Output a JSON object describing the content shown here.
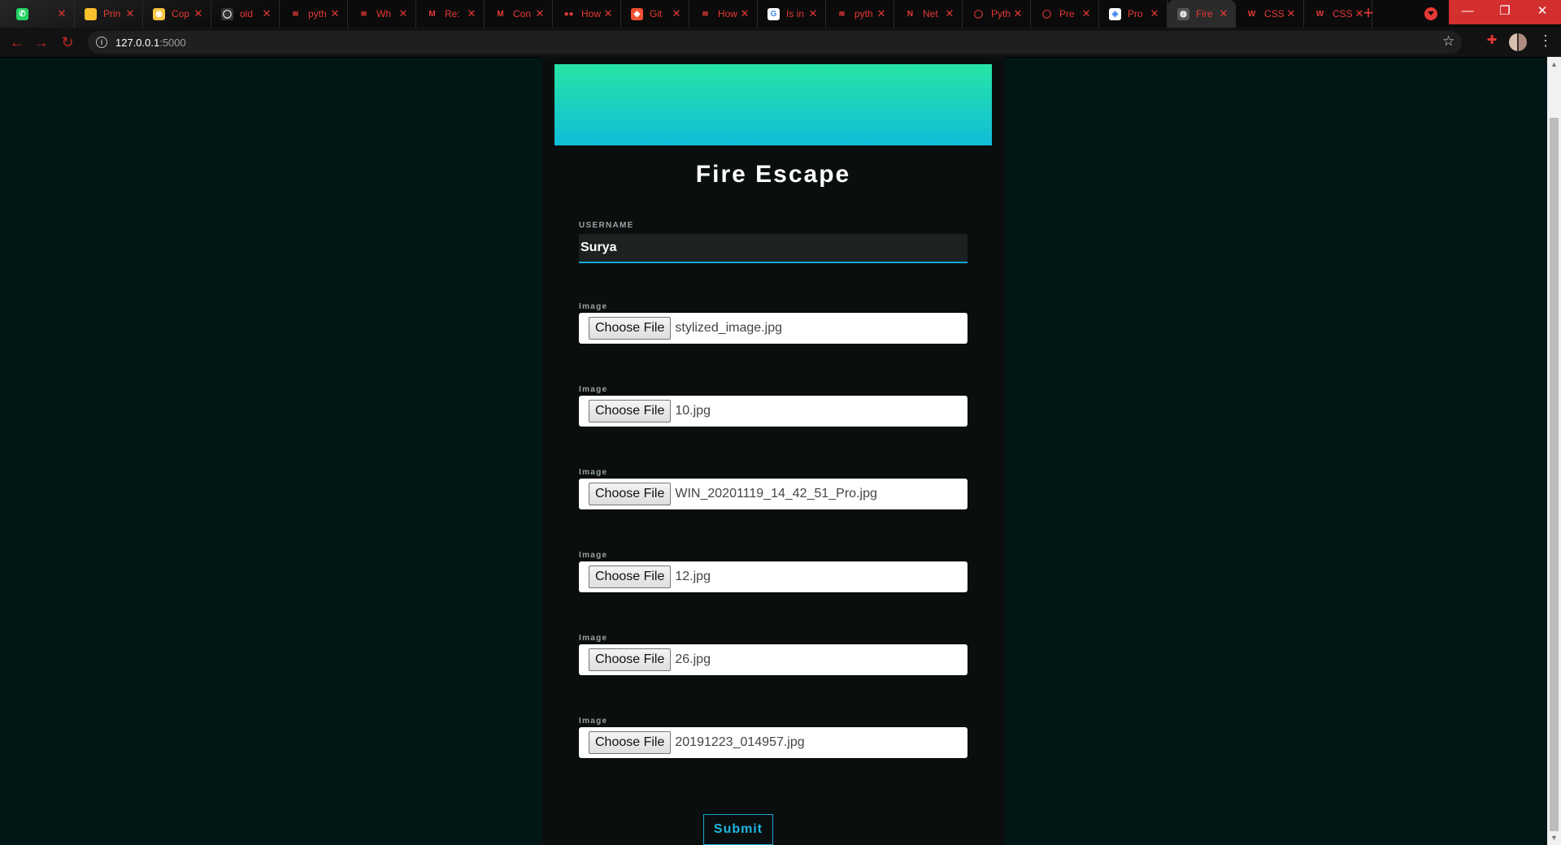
{
  "browser": {
    "tabs": [
      {
        "icon": "whatsapp-icon",
        "title": "",
        "fav_bg": "#25d366",
        "fav_glyph": "✆"
      },
      {
        "icon": "document-icon",
        "title": "Prin",
        "fav_bg": "#f9c02e",
        "fav_glyph": ""
      },
      {
        "icon": "copy-icon",
        "title": "Cop",
        "fav_bg": "#f5c542",
        "fav_glyph": "◉"
      },
      {
        "icon": "github-icon",
        "title": "old",
        "fav_bg": "#333333",
        "fav_glyph": "◯"
      },
      {
        "icon": "stackoverflow-icon",
        "title": "pyth",
        "fav_bg": "#0b0b0b",
        "fav_glyph": "≋"
      },
      {
        "icon": "stackoverflow-icon",
        "title": "Wh",
        "fav_bg": "#0b0b0b",
        "fav_glyph": "≋"
      },
      {
        "icon": "gmail-icon",
        "title": "Re:",
        "fav_bg": "#0b0b0b",
        "fav_glyph": "M"
      },
      {
        "icon": "gmail-icon",
        "title": "Con",
        "fav_bg": "#0b0b0b",
        "fav_glyph": "M"
      },
      {
        "icon": "medium-icon",
        "title": "How",
        "fav_bg": "#0b0b0b",
        "fav_glyph": "●●"
      },
      {
        "icon": "git-icon",
        "title": "Git",
        "fav_bg": "#f05032",
        "fav_glyph": "◆"
      },
      {
        "icon": "stackoverflow-icon",
        "title": "How",
        "fav_bg": "#0b0b0b",
        "fav_glyph": "≋"
      },
      {
        "icon": "google-icon",
        "title": "Is in",
        "fav_bg": "#ffffff",
        "fav_glyph": "G"
      },
      {
        "icon": "stackoverflow-icon",
        "title": "pyth",
        "fav_bg": "#0b0b0b",
        "fav_glyph": "≋"
      },
      {
        "icon": "netflix-icon",
        "title": "Net",
        "fav_bg": "#0b0b0b",
        "fav_glyph": "N"
      },
      {
        "icon": "python-icon",
        "title": "Pyth",
        "fav_bg": "#0b0b0b",
        "fav_glyph": "◯"
      },
      {
        "icon": "power-icon",
        "title": "Pre",
        "fav_bg": "#0b0b0b",
        "fav_glyph": "◯"
      },
      {
        "icon": "code-icon",
        "title": "Pro",
        "fav_bg": "#ffffff",
        "fav_glyph": "◈"
      },
      {
        "icon": "globe-icon",
        "title": "Fire",
        "fav_bg": "#555555",
        "fav_glyph": "◍"
      },
      {
        "icon": "w3schools-icon",
        "title": "CSS",
        "fav_bg": "#0b0b0b",
        "fav_glyph": "W"
      },
      {
        "icon": "w3schools-icon",
        "title": "CSS",
        "fav_bg": "#0b0b0b",
        "fav_glyph": "W"
      }
    ],
    "active_tab_index": 17,
    "url_host": "127.0.0.1",
    "url_port": ":5000"
  },
  "form": {
    "title": "Fire Escape",
    "username_label": "USERNAME",
    "username_value": "Surya",
    "image_label": "Image",
    "choose_file_label": "Choose File",
    "files": [
      "stylized_image.jpg",
      "10.jpg",
      "WIN_20201119_14_42_51_Pro.jpg",
      "12.jpg",
      "26.jpg",
      "20191223_014957.jpg"
    ],
    "submit_label": "Submit"
  },
  "colors": {
    "page_bg": "#031616",
    "card_bg": "#0a0e0e",
    "banner_top": "#27e5a4",
    "banner_bottom": "#10bdd9",
    "accent": "#16a6d1",
    "browser_accent": "#e53935"
  }
}
